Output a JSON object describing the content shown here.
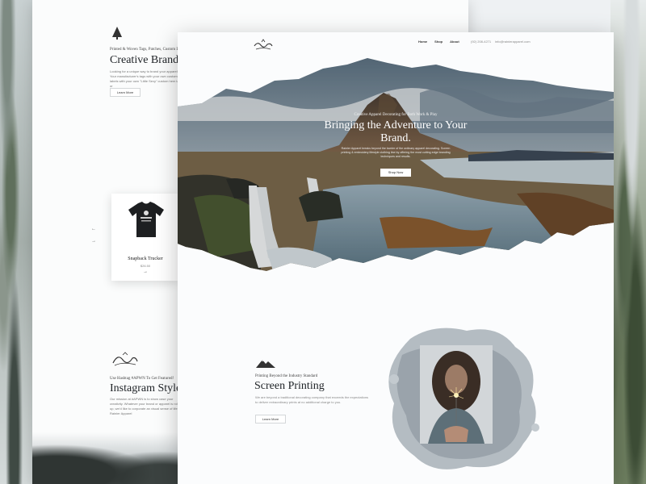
{
  "back_page": {
    "kicker": "Printed & Woven Tags, Patches, Custom Labels",
    "heading": "Creative Brand",
    "body": "Looking for a unique way to brand your apparel? Your manufacturer's tags with your own custom labels with your own \"Little Sexy\" custom hem tags or",
    "learn_more": "Learn More",
    "product": {
      "name": "Snapback Trucker",
      "price": "$26.50",
      "arrow": "→"
    },
    "prev_arrow": "←",
    "next_arrow": "→",
    "insta_kicker": "Use Hashtag #APWN To Get Featured!",
    "insta_heading": "Instagram Styles",
    "insta_body": "Our mission at #APWN is to show case your creativity. Whatever your brand or apparel is rolling up, we'd like to corporate an visual sense of life Rainier Apparel"
  },
  "nav": {
    "links": [
      "Home",
      "Shop",
      "About"
    ],
    "phone": "(92) 208-4271",
    "email": "info@rainierapparel.com"
  },
  "hero": {
    "kicker": "Creative Apparel Decorating for Both Work & Play",
    "title": "Bringing the Adventure to Your Brand.",
    "body": "Rainier Apparel breaks beyond the barrier of the ordinary apparel decorating. Screen printing & embroidery lifestyle clothing line by offering the most cutting edge branding techniques and results.",
    "button": "Shop Now"
  },
  "screen_printing": {
    "kicker": "Printing Beyond the Industry Standard",
    "heading": "Screen Printing",
    "body": "We are beyond a traditional decorating company that exceeds the expectations to deliver extraordinary prints at no additional charge to you.",
    "button": "Learn More"
  },
  "colors": {
    "page_bg": "#fbfcfd",
    "accent_dark": "#1e2226"
  }
}
